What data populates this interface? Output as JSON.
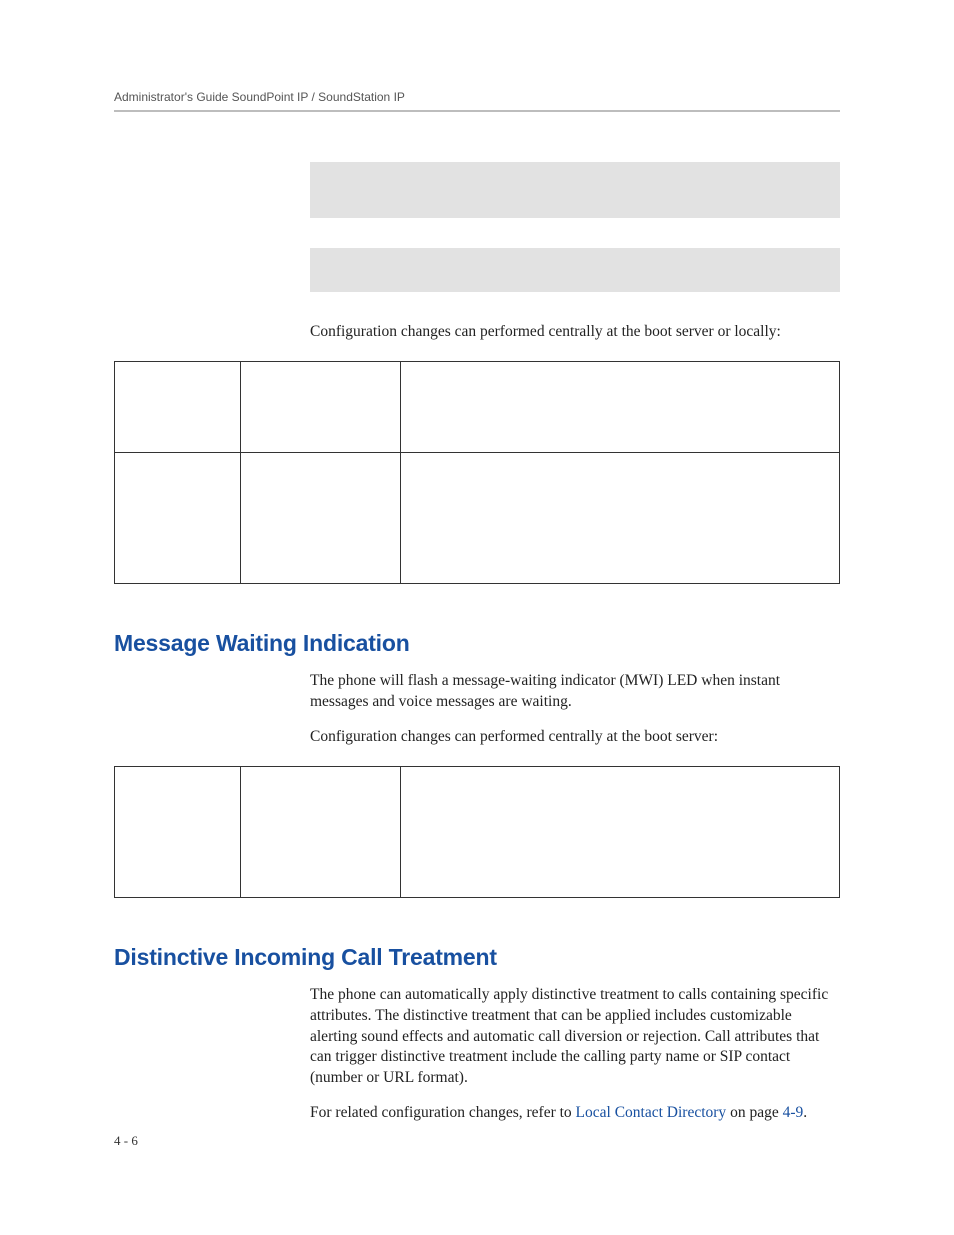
{
  "header": {
    "running_title": "Administrator's Guide SoundPoint IP / SoundStation IP"
  },
  "intro": {
    "config_changes_text": "Configuration changes can performed centrally at the boot server or locally:"
  },
  "sections": {
    "mwi": {
      "title": "Message Waiting Indication",
      "p1": "The phone will flash a message-waiting indicator (MWI) LED when instant messages and voice messages are waiting.",
      "p2": "Configuration changes can performed centrally at the boot server:"
    },
    "distinctive": {
      "title": "Distinctive Incoming Call Treatment",
      "p1": "The phone can automatically apply distinctive treatment to calls containing specific attributes. The distinctive treatment that can be applied includes customizable alerting sound effects and automatic call diversion or rejection. Call attributes that can trigger distinctive treatment include the calling party name or SIP contact (number or URL format).",
      "p2_pre": "For related configuration changes, refer to ",
      "p2_link": "Local Contact Directory",
      "p2_mid": " on page ",
      "p2_pageref": "4-9",
      "p2_post": "."
    }
  },
  "footer": {
    "page_number": "4 - 6"
  }
}
